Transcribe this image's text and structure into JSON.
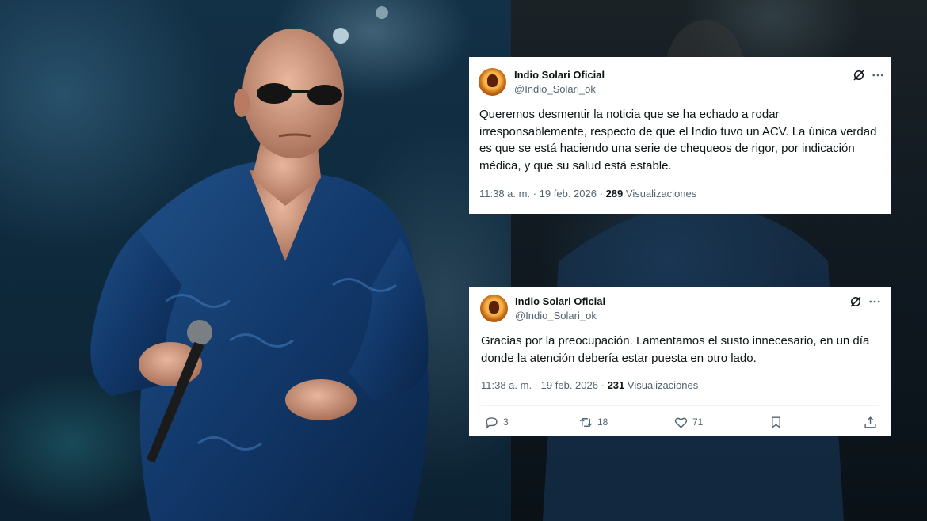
{
  "tweets": [
    {
      "display_name": "Indio Solari Oficial",
      "handle": "@Indio_Solari_ok",
      "text": "Queremos desmentir la noticia que se ha echado a rodar irresponsablemente, respecto de que el Indio tuvo un ACV. La única verdad es que se está haciendo una serie de chequeos de rigor, por indicación médica, y que su salud está estable.",
      "time": "11:38 a. m.",
      "date": "19 feb. 2026",
      "views_count": "289",
      "views_label": "Visualizaciones"
    },
    {
      "display_name": "Indio Solari Oficial",
      "handle": "@Indio_Solari_ok",
      "text": "Gracias por la preocupación. Lamentamos el susto innecesario, en un día donde la atención debería estar puesta en otro lado.",
      "time": "11:38 a. m.",
      "date": "19 feb. 2026",
      "views_count": "231",
      "views_label": "Visualizaciones",
      "actions": {
        "replies": "3",
        "retweets": "18",
        "likes": "71"
      }
    }
  ],
  "separator": "·",
  "icons": [
    "grok-icon",
    "more-icon",
    "reply-icon",
    "retweet-icon",
    "like-icon",
    "bookmark-icon",
    "share-icon"
  ],
  "colors": {
    "primary_text": "#0f1419",
    "secondary_text": "#536471",
    "card_bg": "#ffffff"
  }
}
